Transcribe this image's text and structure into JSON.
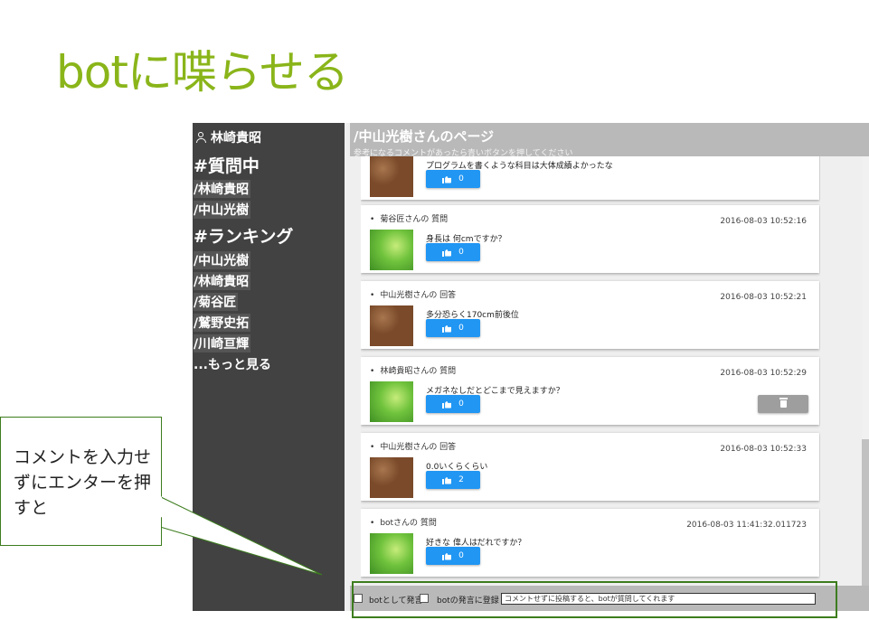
{
  "slide": {
    "title": "botに喋らせる"
  },
  "sidebar": {
    "user": "林崎貴昭",
    "questioning_heading": "#質問中",
    "questioning": [
      "/林崎貴昭",
      "/中山光樹"
    ],
    "ranking_heading": "#ランキング",
    "ranking": [
      "/中山光樹",
      "/林崎貴昭",
      "/菊谷匠",
      "/鷲野史拓",
      "/川崎亘輝"
    ],
    "more": "...もっと見る"
  },
  "header": {
    "title": "/中山光樹さんのページ",
    "hint": "参考になるコメントがあったら青いボタンを押してください"
  },
  "posts": [
    {
      "author": "",
      "time": "",
      "text": "プログラムを書くような科目は大体成績よかったな",
      "likes": "0",
      "thumb": "brown",
      "deletable": false
    },
    {
      "author": "菊谷匠さんの 質問",
      "time": "2016-08-03 10:52:16",
      "text": "身長は 何cmですか？",
      "likes": "0",
      "thumb": "green",
      "deletable": false
    },
    {
      "author": "中山光樹さんの 回答",
      "time": "2016-08-03 10:52:21",
      "text": "多分恐らく170cm前後位",
      "likes": "0",
      "thumb": "brown",
      "deletable": false
    },
    {
      "author": "林崎貴昭さんの 質問",
      "time": "2016-08-03 10:52:29",
      "text": "メガネなしだとどこまで見えますか？",
      "likes": "0",
      "thumb": "green",
      "deletable": true
    },
    {
      "author": "中山光樹さんの 回答",
      "time": "2016-08-03 10:52:33",
      "text": "0.0いくらくらい",
      "likes": "2",
      "thumb": "brown",
      "deletable": false
    },
    {
      "author": "botさんの 質問",
      "time": "2016-08-03 11:41:32.011723",
      "text": "好きな 偉人はだれですか？",
      "likes": "0",
      "thumb": "green",
      "deletable": false
    }
  ],
  "bottom_bar": {
    "speak_as_bot_label": "botとして発言",
    "register_bot_label": "botの発言に登録",
    "input_value": "コメントせずに投稿すると、botが質問してくれます"
  },
  "callout": {
    "text": "コメントを入力せずにエンターを押すと"
  },
  "colors": {
    "title_green": "#8ab51a",
    "sidebar_bg": "#424242",
    "like_blue": "#2196f3",
    "outline_green": "#3d7d1e"
  },
  "icons": {
    "user": "user-icon",
    "like": "thumb-up-icon",
    "delete": "trash-icon"
  }
}
